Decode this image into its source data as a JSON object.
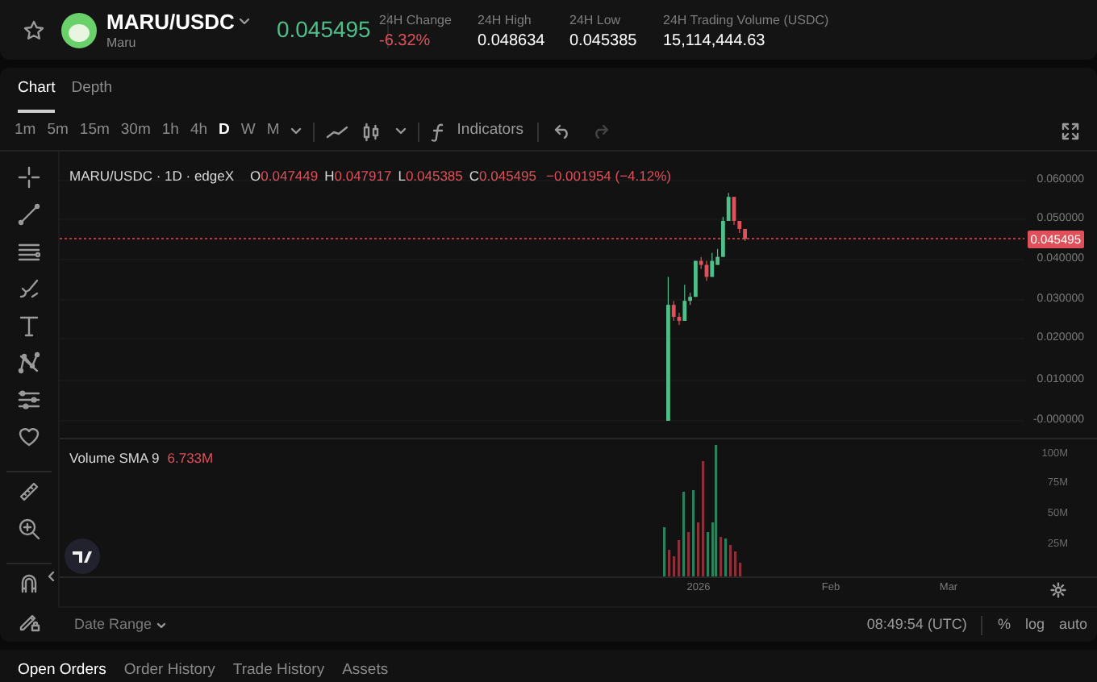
{
  "header": {
    "pair": "MARU/USDC",
    "name": "Maru",
    "price": "0.045495",
    "stats": [
      {
        "label": "24H Change",
        "value": "-6.32%",
        "color": "#e0505a"
      },
      {
        "label": "24H High",
        "value": "0.048634",
        "color": "#ffffff"
      },
      {
        "label": "24H Low",
        "value": "0.045385",
        "color": "#ffffff"
      },
      {
        "label": "24H Trading Volume (USDC)",
        "value": "15,114,444.63",
        "color": "#ffffff"
      }
    ]
  },
  "chart_tabs": [
    {
      "label": "Chart",
      "selected": true
    },
    {
      "label": "Depth",
      "selected": false
    }
  ],
  "intervals": [
    {
      "label": "1m",
      "selected": false
    },
    {
      "label": "5m",
      "selected": false
    },
    {
      "label": "15m",
      "selected": false
    },
    {
      "label": "30m",
      "selected": false
    },
    {
      "label": "1h",
      "selected": false
    },
    {
      "label": "4h",
      "selected": false
    },
    {
      "label": "D",
      "selected": true
    },
    {
      "label": "W",
      "selected": false
    },
    {
      "label": "M",
      "selected": false
    }
  ],
  "indicators_label": "Indicators",
  "legend": {
    "title": "MARU/USDC · 1D · edgeX",
    "ohlc": [
      {
        "key": "O",
        "value": "0.047449"
      },
      {
        "key": "H",
        "value": "0.047917"
      },
      {
        "key": "L",
        "value": "0.045385"
      },
      {
        "key": "C",
        "value": "0.045495"
      }
    ],
    "change": "−0.001954 (−4.12%)"
  },
  "price_axis": [
    "0.060000",
    "0.050000",
    "0.040000",
    "0.030000",
    "0.020000",
    "0.010000",
    "-0.000000"
  ],
  "last_price": "0.045495",
  "volume": {
    "label": "Volume SMA 9",
    "value": "6.733M",
    "axis": [
      "100M",
      "75M",
      "50M",
      "25M"
    ]
  },
  "time_axis": [
    "2026",
    "Feb",
    "Mar"
  ],
  "footer": {
    "date_range": "Date Range",
    "time": "08:49:54 (UTC)",
    "options": [
      "%",
      "log",
      "auto"
    ]
  },
  "bottom_tabs": [
    {
      "label": "Open Orders",
      "selected": true
    },
    {
      "label": "Order History",
      "selected": false
    },
    {
      "label": "Trade History",
      "selected": false
    },
    {
      "label": "Assets",
      "selected": false
    }
  ]
}
